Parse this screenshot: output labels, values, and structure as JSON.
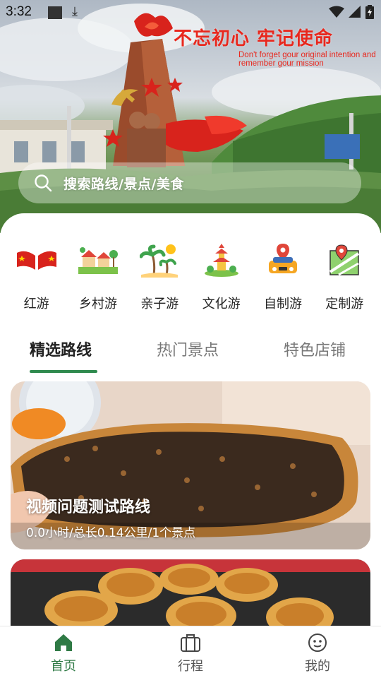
{
  "status_bar": {
    "time": "3:32"
  },
  "hero": {
    "slogan_cn": "不忘初心 牢记使命",
    "slogan_en": "Don't forget gour original intention and remember gour mission"
  },
  "search": {
    "placeholder": "搜索路线/景点/美食"
  },
  "categories": [
    {
      "label": "红游",
      "icon": "red-flags-icon"
    },
    {
      "label": "乡村游",
      "icon": "village-icon"
    },
    {
      "label": "亲子游",
      "icon": "palm-beach-icon"
    },
    {
      "label": "文化游",
      "icon": "pagoda-icon"
    },
    {
      "label": "自制游",
      "icon": "car-pin-icon"
    },
    {
      "label": "定制游",
      "icon": "map-pin-icon"
    }
  ],
  "tabs": [
    {
      "label": "精选路线",
      "active": true
    },
    {
      "label": "热门景点",
      "active": false
    },
    {
      "label": "特色店铺",
      "active": false
    }
  ],
  "routes": [
    {
      "title": "视频问题测试路线",
      "subtitle": "0.0小时/总长0.14公里/1个景点"
    }
  ],
  "bottom_nav": [
    {
      "label": "首页",
      "icon": "home-icon",
      "active": true
    },
    {
      "label": "行程",
      "icon": "suitcase-icon",
      "active": false
    },
    {
      "label": "我的",
      "icon": "profile-face-icon",
      "active": false
    }
  ],
  "colors": {
    "accent": "#2f8a4e",
    "slogan": "#e8281e"
  }
}
